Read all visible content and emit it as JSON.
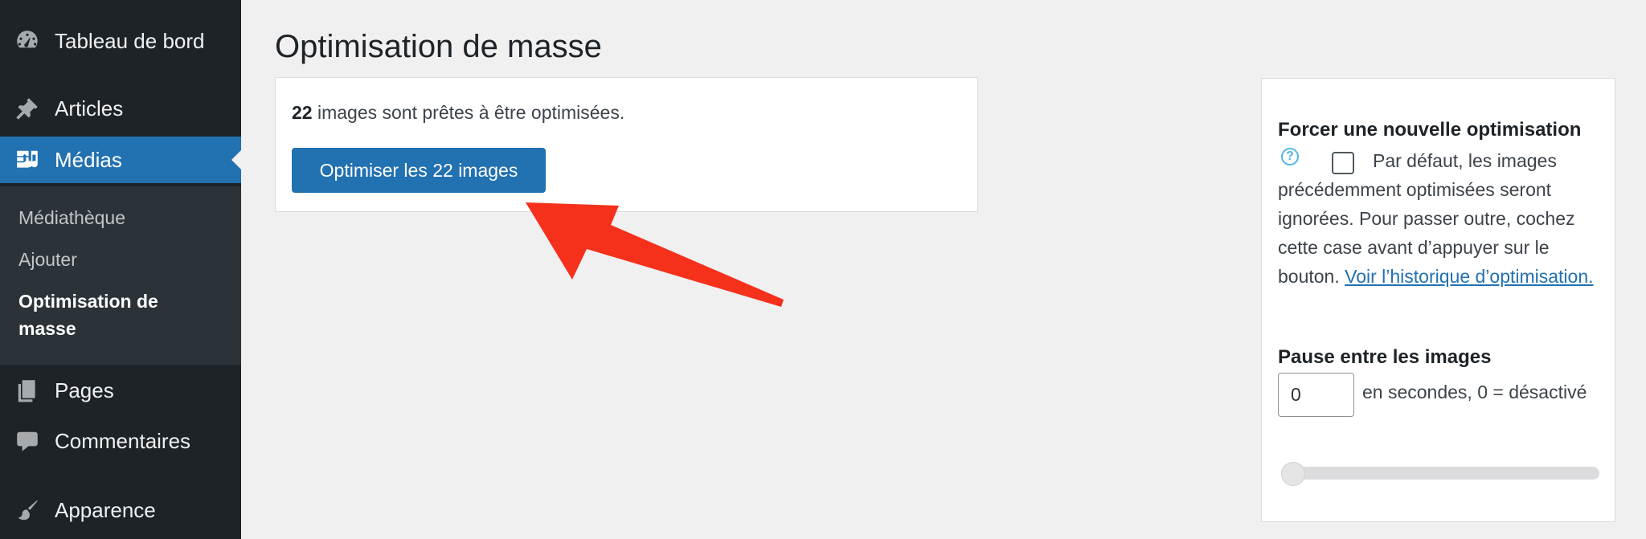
{
  "sidebar": {
    "items": [
      {
        "label": "Tableau de bord",
        "icon": "dashboard-icon"
      },
      {
        "label": "Articles",
        "icon": "pushpin-icon"
      },
      {
        "label": "Médias",
        "icon": "media-icon"
      },
      {
        "label": "Pages",
        "icon": "pages-icon"
      },
      {
        "label": "Commentaires",
        "icon": "comment-icon"
      },
      {
        "label": "Apparence",
        "icon": "paintbrush-icon"
      }
    ],
    "submenu": [
      {
        "label": "Médiathèque"
      },
      {
        "label": "Ajouter"
      },
      {
        "label_line1": "Optimisation de",
        "label_line2": "masse"
      }
    ]
  },
  "main": {
    "title": "Optimisation de masse",
    "ready_count": "22",
    "ready_text": " images sont prêtes à être optimisées.",
    "optimize_button": "Optimiser les 22 images"
  },
  "panel": {
    "force_title": "Forcer une nouvelle optimisation",
    "help_icon_glyph": "?",
    "force_desc": "Par défaut, les images précédemment optimisées seront ignorées. Pour passer outre, cochez cette case avant d’appuyer sur le bouton. ",
    "history_link": "Voir l’historique d’optimisation.",
    "pause_title": "Pause entre les images",
    "pause_value": "0",
    "pause_desc": "en secondes, 0 = désactivé",
    "slider_level": 0
  },
  "colors": {
    "sidebar_bg": "#1d2327",
    "accent": "#2271b1",
    "arrow": "#f5311c"
  }
}
